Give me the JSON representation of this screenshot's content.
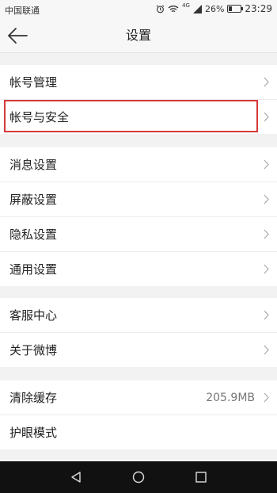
{
  "status_bar": {
    "carrier": "中国联通",
    "battery": "26%",
    "battery_level": 0.26,
    "time": "23:29",
    "network": "4G"
  },
  "header": {
    "title": "设置"
  },
  "groups": [
    {
      "items": [
        {
          "label": "帐号管理"
        },
        {
          "label": "帐号与安全"
        }
      ]
    },
    {
      "items": [
        {
          "label": "消息设置"
        },
        {
          "label": "屏蔽设置"
        },
        {
          "label": "隐私设置"
        },
        {
          "label": "通用设置"
        }
      ]
    },
    {
      "items": [
        {
          "label": "客服中心"
        },
        {
          "label": "关于微博"
        }
      ]
    },
    {
      "items": [
        {
          "label": "清除缓存",
          "value": "205.9MB"
        },
        {
          "label": "护眼模式"
        }
      ]
    }
  ],
  "icons": {
    "back": "arrow-left-icon",
    "chevron": "chevron-right-icon",
    "alarm": "alarm-icon",
    "wifi": "wifi-icon",
    "signal": "signal-icon",
    "battery": "battery-icon",
    "nav_back": "triangle-back-icon",
    "nav_home": "circle-home-icon",
    "nav_recents": "square-recents-icon"
  },
  "colors": {
    "highlight": "#d43a3a",
    "background": "#f2f2f2",
    "nav_bar": "#111111"
  }
}
